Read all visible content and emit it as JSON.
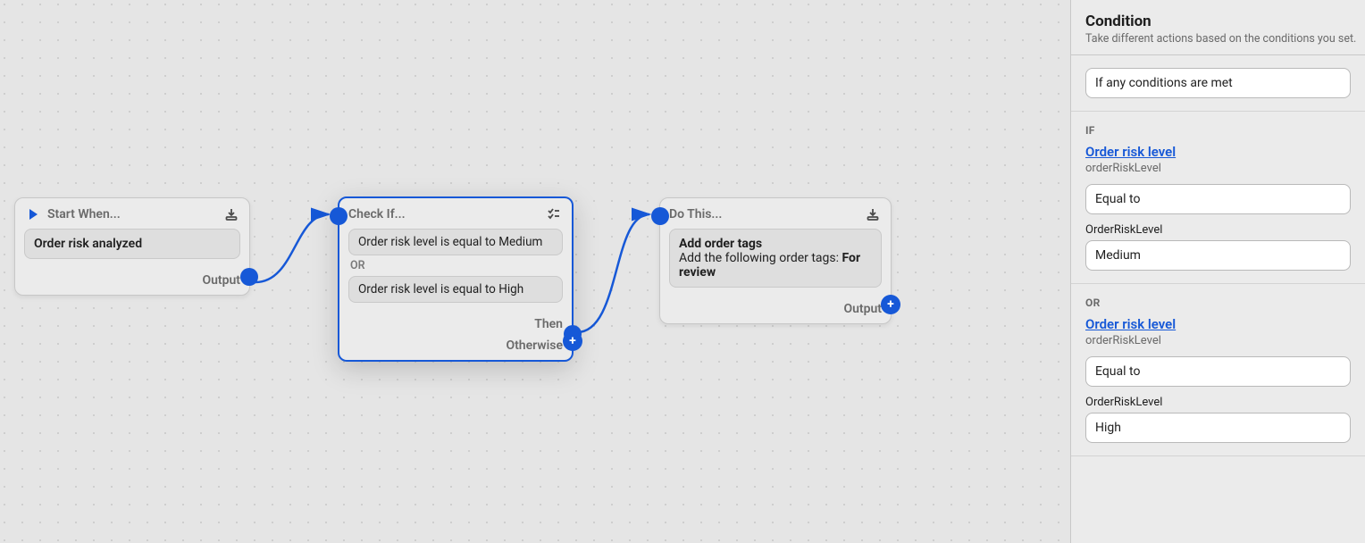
{
  "canvas": {
    "nodes": {
      "start": {
        "header": "Start When...",
        "trigger": "Order risk analyzed",
        "output_label": "Output"
      },
      "check": {
        "header": "Check If...",
        "conditions": [
          "Order risk level is equal to Medium",
          "Order risk level is equal to High"
        ],
        "or_label": "OR",
        "then_label": "Then",
        "otherwise_label": "Otherwise"
      },
      "do": {
        "header": "Do This...",
        "action_title": "Add order tags",
        "action_desc_prefix": "Add the following order tags: ",
        "action_desc_bold": "For review",
        "output_label": "Output"
      }
    }
  },
  "sidebar": {
    "title": "Condition",
    "subtitle": "Take different actions based on the conditions you set.",
    "match_mode": "If any conditions are met",
    "if_label": "IF",
    "or_label": "OR",
    "conditions": [
      {
        "variable_label": "Order risk level",
        "variable_name": "orderRiskLevel",
        "operator": "Equal to",
        "value_field_label": "OrderRiskLevel",
        "value": "Medium"
      },
      {
        "variable_label": "Order risk level",
        "variable_name": "orderRiskLevel",
        "operator": "Equal to",
        "value_field_label": "OrderRiskLevel",
        "value": "High"
      }
    ]
  }
}
